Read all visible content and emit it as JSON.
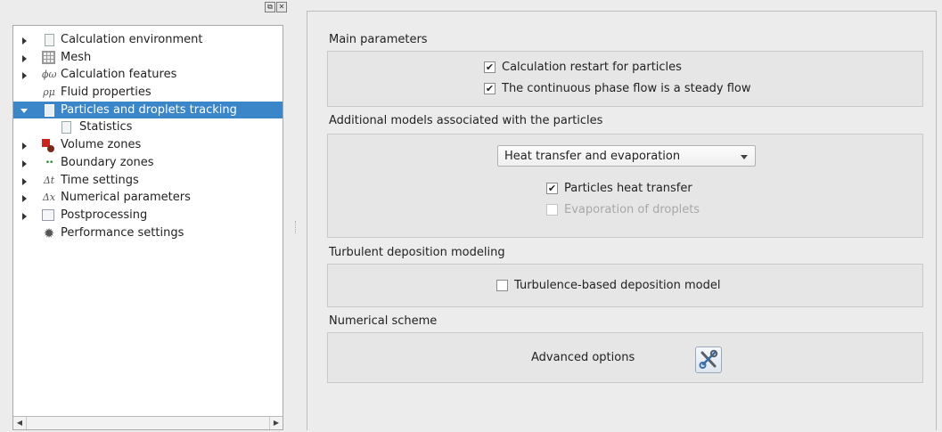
{
  "dock": {
    "float_glyph": "⧉",
    "close_glyph": "✕"
  },
  "tree": {
    "items": [
      {
        "label": "Calculation environment",
        "icon": "document-icon",
        "expandable": true
      },
      {
        "label": "Mesh",
        "icon": "mesh-icon",
        "expandable": true
      },
      {
        "label": "Calculation features",
        "icon": "phi-omega-icon",
        "icon_text": "ϕω",
        "expandable": true
      },
      {
        "label": "Fluid properties",
        "icon": "rho-mu-icon",
        "icon_text": "ρμ",
        "expandable": false
      },
      {
        "label": "Particles and droplets tracking",
        "icon": "document-icon",
        "expandable": true,
        "expanded": true,
        "selected": true
      },
      {
        "label": "Statistics",
        "icon": "document-icon",
        "child": true
      },
      {
        "label": "Volume zones",
        "icon": "volume-zones-icon",
        "expandable": true
      },
      {
        "label": "Boundary zones",
        "icon": "boundary-zones-icon",
        "icon_text": "••",
        "expandable": true
      },
      {
        "label": "Time settings",
        "icon": "delta-t-icon",
        "icon_text": "Δt",
        "expandable": true
      },
      {
        "label": "Numerical parameters",
        "icon": "delta-x-icon",
        "icon_text": "Δx",
        "expandable": true
      },
      {
        "label": "Postprocessing",
        "icon": "postprocessing-icon",
        "expandable": true
      },
      {
        "label": "Performance settings",
        "icon": "gear-icon",
        "icon_text": "✹",
        "expandable": false
      }
    ],
    "scroll_left": "◀",
    "scroll_right": "▶"
  },
  "main_params": {
    "title": "Main parameters",
    "restart_label": "Calculation restart for particles",
    "restart_checked": true,
    "steady_label": "The continuous phase flow is a steady flow",
    "steady_checked": true
  },
  "additional_models": {
    "title": "Additional models associated with the particles",
    "combo_value": "Heat transfer and evaporation",
    "heat_label": "Particles heat transfer",
    "heat_checked": true,
    "evap_label": "Evaporation of droplets",
    "evap_checked": false,
    "evap_disabled": true
  },
  "turbulent": {
    "title": "Turbulent deposition modeling",
    "model_label": "Turbulence-based deposition model",
    "model_checked": false
  },
  "numerical": {
    "title": "Numerical scheme",
    "advanced_label": "Advanced options"
  },
  "check_glyph": "✔",
  "colors": {
    "selection": "#3b86c8",
    "background": "#ececec"
  }
}
